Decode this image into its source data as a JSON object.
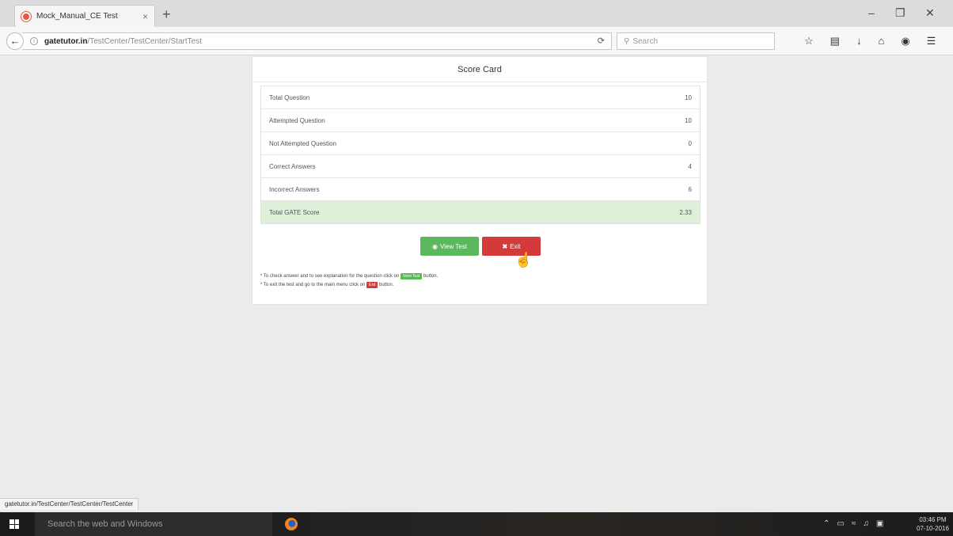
{
  "browser": {
    "tab_title": "Mock_Manual_CE Test",
    "tab_close": "×",
    "new_tab": "+",
    "url_host": "gatetutor.in",
    "url_path": "/TestCenter/TestCenter/StartTest",
    "search_placeholder": "Search",
    "status_url": "gatetutor.in/TestCenter/TestCenter/TestCenter"
  },
  "scorecard": {
    "title": "Score Card",
    "rows": [
      {
        "label": "Total Question",
        "value": "10"
      },
      {
        "label": "Attempted Question",
        "value": "10"
      },
      {
        "label": "Not Attempted Question",
        "value": "0"
      },
      {
        "label": "Correct Answers",
        "value": "4"
      },
      {
        "label": "Incorrect Answers",
        "value": "6"
      },
      {
        "label": "Total GATE Score",
        "value": "2.33"
      }
    ],
    "view_test_label": "View Test",
    "exit_label": "Exit",
    "note1_prefix": "* To check answer and to see explanation for the question click on",
    "note1_tag": "View Test",
    "note1_suffix": "button.",
    "note2_prefix": "* To exit the test and go to the main menu click on",
    "note2_tag": "Exit",
    "note2_suffix": "button."
  },
  "taskbar": {
    "search_placeholder": "Search the web and Windows",
    "time": "03:46 PM",
    "date": "07-10-2016"
  },
  "colors": {
    "success": "#5cb85c",
    "danger": "#d43a3a",
    "score_row_bg": "#dff0d8"
  }
}
